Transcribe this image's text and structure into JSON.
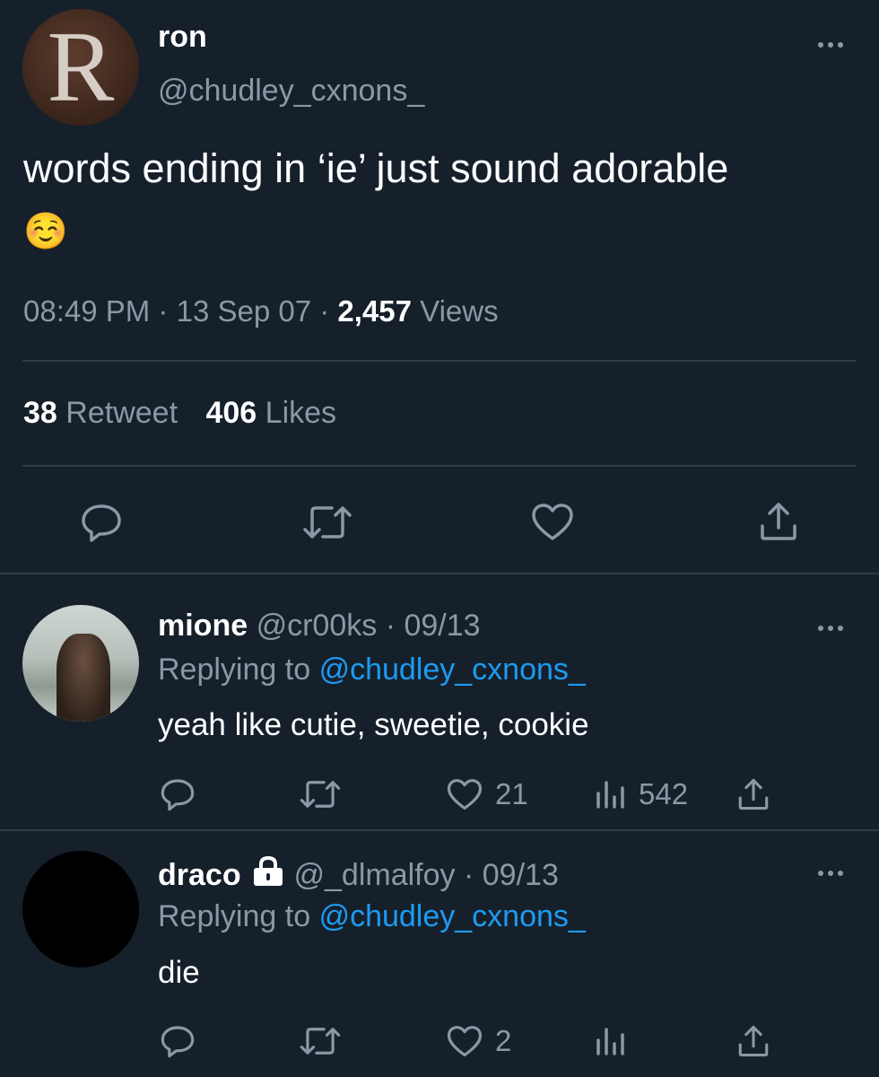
{
  "main_tweet": {
    "avatar_letter": "R",
    "display_name": "ron",
    "handle": "@chudley_cxnons_",
    "text": "words ending in ‘ie’ just sound adorable",
    "emoji": "☺️",
    "time": "08:49 PM",
    "date": "13 Sep 07",
    "views_count": "2,457",
    "views_label": "Views",
    "retweet_count": "38",
    "retweet_label": "Retweet",
    "likes_count": "406",
    "likes_label": "Likes"
  },
  "replies": [
    {
      "display_name": "mione",
      "handle": "@cr00ks",
      "date": "09/13",
      "replying_label": "Replying to",
      "replying_handle": "@chudley_cxnons_",
      "text": "yeah like cutie, sweetie, cookie",
      "likes": "21",
      "views": "542"
    },
    {
      "display_name": "draco",
      "handle": "@_dlmalfoy",
      "date": "09/13",
      "replying_label": "Replying to",
      "replying_handle": "@chudley_cxnons_",
      "text": "die",
      "likes": "2",
      "views": ""
    }
  ],
  "separator": "·",
  "colors": {
    "background": "#15202b",
    "muted": "#8b98a5",
    "link": "#1d9bf0",
    "divider": "#2f3b47"
  }
}
